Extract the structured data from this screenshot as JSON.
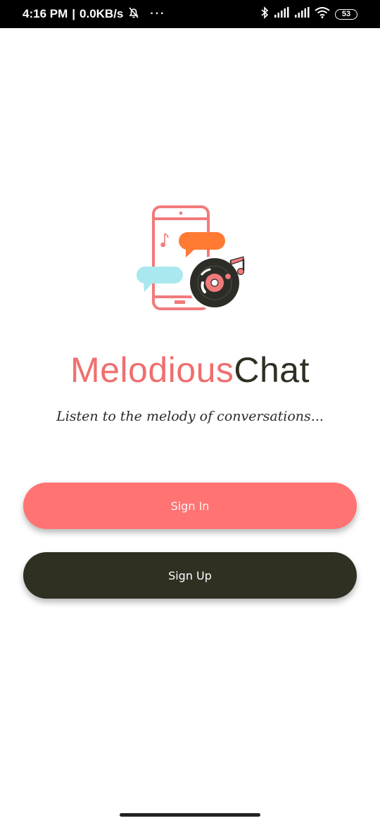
{
  "status_bar": {
    "time": "4:16 PM",
    "separator": "|",
    "network_speed": "0.0KB/s",
    "more_dots": "···",
    "battery_level": "53",
    "icons": [
      "alarm-off-icon",
      "bluetooth-icon",
      "signal-icon",
      "signal-icon",
      "wifi-icon",
      "battery-icon"
    ]
  },
  "app": {
    "title_part1": "Melodious",
    "title_part2": "Chat",
    "tagline": "Listen to the melody of conversations..."
  },
  "buttons": {
    "sign_in": "Sign In",
    "sign_up": "Sign Up"
  },
  "colors": {
    "accent_coral": "#ff7373",
    "title_coral": "#f06f6f",
    "dark": "#2f2f22",
    "orange_bubble": "#ff7a33",
    "cyan_bubble": "#a8e8ee"
  }
}
